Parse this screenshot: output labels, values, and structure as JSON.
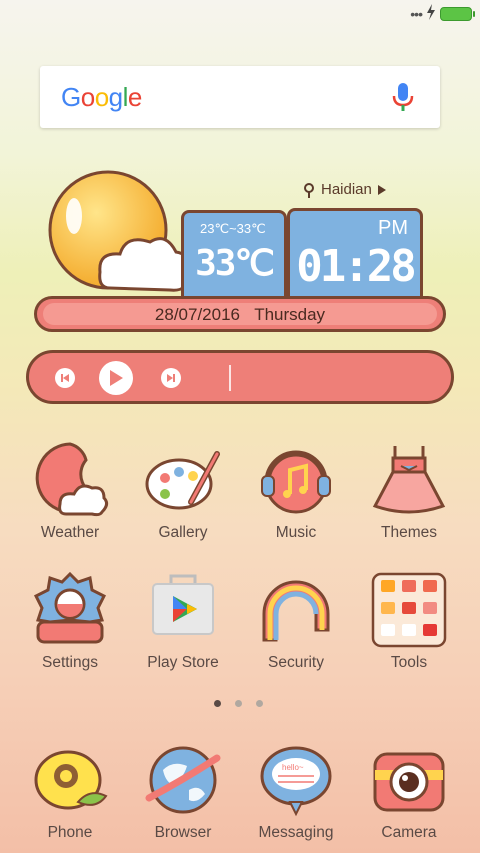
{
  "status": {
    "dots": "•••"
  },
  "search": {
    "logo": "Google"
  },
  "weather_widget": {
    "location": "Haidian",
    "temp_range": "23℃~33℃",
    "temp_now": "33℃",
    "ampm": "PM",
    "time": "01:28",
    "date": "28/07/2016",
    "weekday": "Thursday"
  },
  "apps": [
    {
      "label": "Weather"
    },
    {
      "label": "Gallery"
    },
    {
      "label": "Music"
    },
    {
      "label": "Themes"
    },
    {
      "label": "Settings"
    },
    {
      "label": "Play Store"
    },
    {
      "label": "Security"
    },
    {
      "label": "Tools"
    }
  ],
  "dock": [
    {
      "label": "Phone"
    },
    {
      "label": "Browser"
    },
    {
      "label": "Messaging"
    },
    {
      "label": "Camera"
    }
  ],
  "messaging_icon_text": "hello~",
  "colors": {
    "accent": "#ee7f78",
    "outline": "#7a4630",
    "sky": "#7fb2e0"
  }
}
